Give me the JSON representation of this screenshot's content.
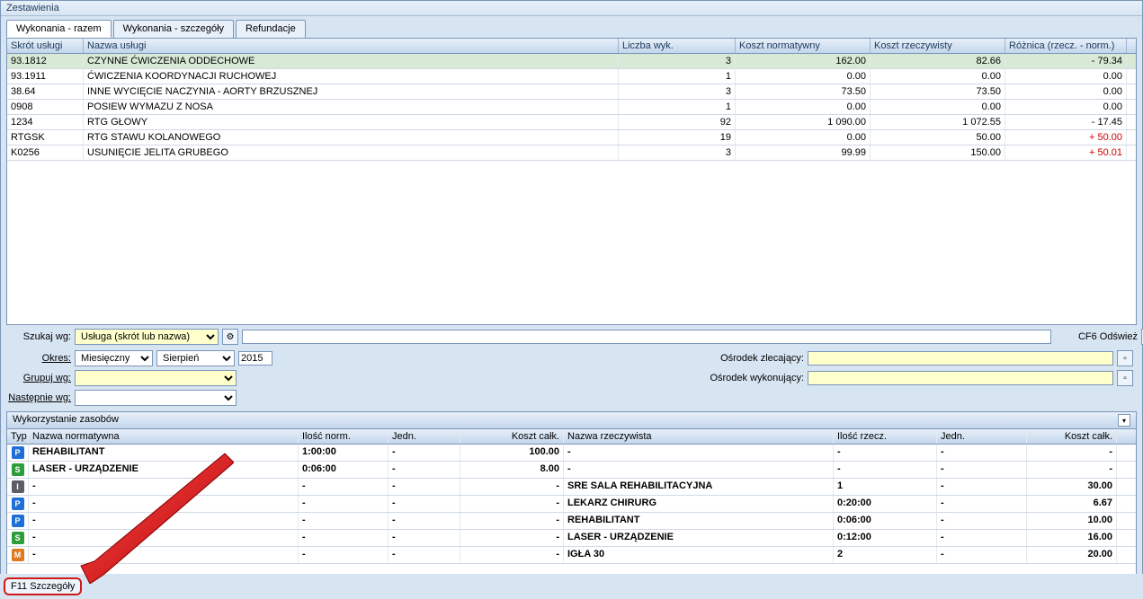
{
  "window": {
    "title": "Zestawienia"
  },
  "tabs": [
    {
      "label": "Wykonania - razem",
      "active": true
    },
    {
      "label": "Wykonania - szczegóły",
      "active": false
    },
    {
      "label": "Refundacje",
      "active": false
    }
  ],
  "grid": {
    "headers": {
      "skrot": "Skrót usługi",
      "nazwa": "Nazwa usługi",
      "liczba": "Liczba wyk.",
      "koszt_norm": "Koszt normatywny",
      "koszt_rzecz": "Koszt rzeczywisty",
      "roznica": "Różnica (rzecz. - norm.)"
    },
    "rows": [
      {
        "sk": "93.1812",
        "nm": "CZYNNE ĆWICZENIA ODDECHOWE",
        "lw": "3",
        "kn": "162.00",
        "kr": "82.66",
        "rz": "- 79.34",
        "sel": true
      },
      {
        "sk": "93.1911",
        "nm": "ĆWICZENIA KOORDYNACJI RUCHOWEJ",
        "lw": "1",
        "kn": "0.00",
        "kr": "0.00",
        "rz": "0.00"
      },
      {
        "sk": "38.64",
        "nm": "INNE WYCIĘCIE NACZYNIA - AORTY BRZUSZNEJ",
        "lw": "3",
        "kn": "73.50",
        "kr": "73.50",
        "rz": "0.00"
      },
      {
        "sk": "0908",
        "nm": "POSIEW WYMAZU Z NOSA",
        "lw": "1",
        "kn": "0.00",
        "kr": "0.00",
        "rz": "0.00"
      },
      {
        "sk": "1234",
        "nm": "RTG GŁOWY",
        "lw": "92",
        "kn": "1 090.00",
        "kr": "1 072.55",
        "rz": "- 17.45"
      },
      {
        "sk": "RTGSK",
        "nm": "RTG STAWU KOLANOWEGO",
        "lw": "19",
        "kn": "0.00",
        "kr": "50.00",
        "rz": "+ 50.00",
        "red": true
      },
      {
        "sk": "K0256",
        "nm": "USUNIĘCIE JELITA GRUBEGO",
        "lw": "3",
        "kn": "99.99",
        "kr": "150.00",
        "rz": "+ 50.01",
        "red": true
      }
    ]
  },
  "filters": {
    "szukaj_label": "Szukaj wg:",
    "szukaj_value": "Usługa (skrót lub nazwa)",
    "refresh_label": "CF6 Odśwież",
    "okres_label": "Okres:",
    "okres_type": "Miesięczny",
    "okres_month": "Sierpień",
    "okres_year": "2015",
    "grupuj_label": "Grupuj wg:",
    "nastepnie_label": "Następnie wg:",
    "osrodek_zlec_label": "Ośrodek zlecający:",
    "osrodek_wyk_label": "Ośrodek wykonujący:"
  },
  "resources": {
    "title": "Wykorzystanie zasobów",
    "headers": {
      "typ": "Typ",
      "nazwa_norm": "Nazwa normatywna",
      "ilosc_norm": "Ilość norm.",
      "jedn_n": "Jedn.",
      "koszt_calk_n": "Koszt całk.",
      "nazwa_rzecz": "Nazwa rzeczywista",
      "ilosc_rzecz": "Ilość rzecz.",
      "jedn_r": "Jedn.",
      "koszt_calk_r": "Koszt całk."
    },
    "rows": [
      {
        "typ": "P",
        "nn": "REHABILITANT",
        "in": "1:00:00",
        "jn": "-",
        "kc": "100.00",
        "nr": "-",
        "ir": "-",
        "jr": "-",
        "kcr": "-",
        "bold": true
      },
      {
        "typ": "S",
        "nn": "LASER - URZĄDZENIE",
        "in": "0:06:00",
        "jn": "-",
        "kc": "8.00",
        "nr": "-",
        "ir": "-",
        "jr": "-",
        "kcr": "-",
        "bold": true
      },
      {
        "typ": "I",
        "nn": "-",
        "in": "-",
        "jn": "-",
        "kc": "-",
        "nr": "SRE SALA REHABILITACYJNA",
        "ir": "1",
        "jr": "-",
        "kcr": "30.00",
        "bold": true
      },
      {
        "typ": "P",
        "nn": "-",
        "in": "-",
        "jn": "-",
        "kc": "-",
        "nr": "LEKARZ CHIRURG",
        "ir": "0:20:00",
        "jr": "-",
        "kcr": "6.67",
        "bold": true
      },
      {
        "typ": "P",
        "nn": "-",
        "in": "-",
        "jn": "-",
        "kc": "-",
        "nr": "REHABILITANT",
        "ir": "0:06:00",
        "jr": "-",
        "kcr": "10.00",
        "bold": true
      },
      {
        "typ": "S",
        "nn": "-",
        "in": "-",
        "jn": "-",
        "kc": "-",
        "nr": "LASER - URZĄDZENIE",
        "ir": "0:12:00",
        "jr": "-",
        "kcr": "16.00",
        "bold": true
      },
      {
        "typ": "M",
        "nn": "-",
        "in": "-",
        "jn": "-",
        "kc": "-",
        "nr": "IGŁA 30",
        "ir": "2",
        "jr": "-",
        "kcr": "20.00",
        "bold": true
      }
    ]
  },
  "footer": {
    "button": "F11 Szczegóły"
  }
}
